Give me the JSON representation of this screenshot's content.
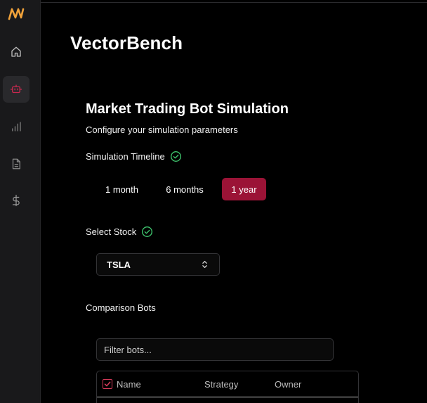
{
  "app": {
    "brand": "VectorBench"
  },
  "sidebar": {
    "items": [
      {
        "name": "home",
        "icon": "home-icon"
      },
      {
        "name": "bots",
        "icon": "robot-icon",
        "active": true
      },
      {
        "name": "analytics",
        "icon": "bar-chart-icon"
      },
      {
        "name": "documents",
        "icon": "document-icon"
      },
      {
        "name": "pricing",
        "icon": "dollar-icon"
      }
    ]
  },
  "page": {
    "title": "Market Trading Bot Simulation",
    "subtitle": "Configure your simulation parameters"
  },
  "timeline": {
    "label": "Simulation Timeline",
    "options": [
      "1 month",
      "6 months",
      "1 year"
    ],
    "selected": "1 year"
  },
  "stock": {
    "label": "Select Stock",
    "value": "TSLA"
  },
  "comparison": {
    "label": "Comparison Bots",
    "filter_placeholder": "Filter bots...",
    "columns": [
      "Name",
      "Strategy",
      "Owner"
    ]
  },
  "colors": {
    "accent": "#9b1336",
    "logo": "#f0a23a",
    "success": "#3ec46d",
    "sidebar_bg": "#19191b"
  }
}
